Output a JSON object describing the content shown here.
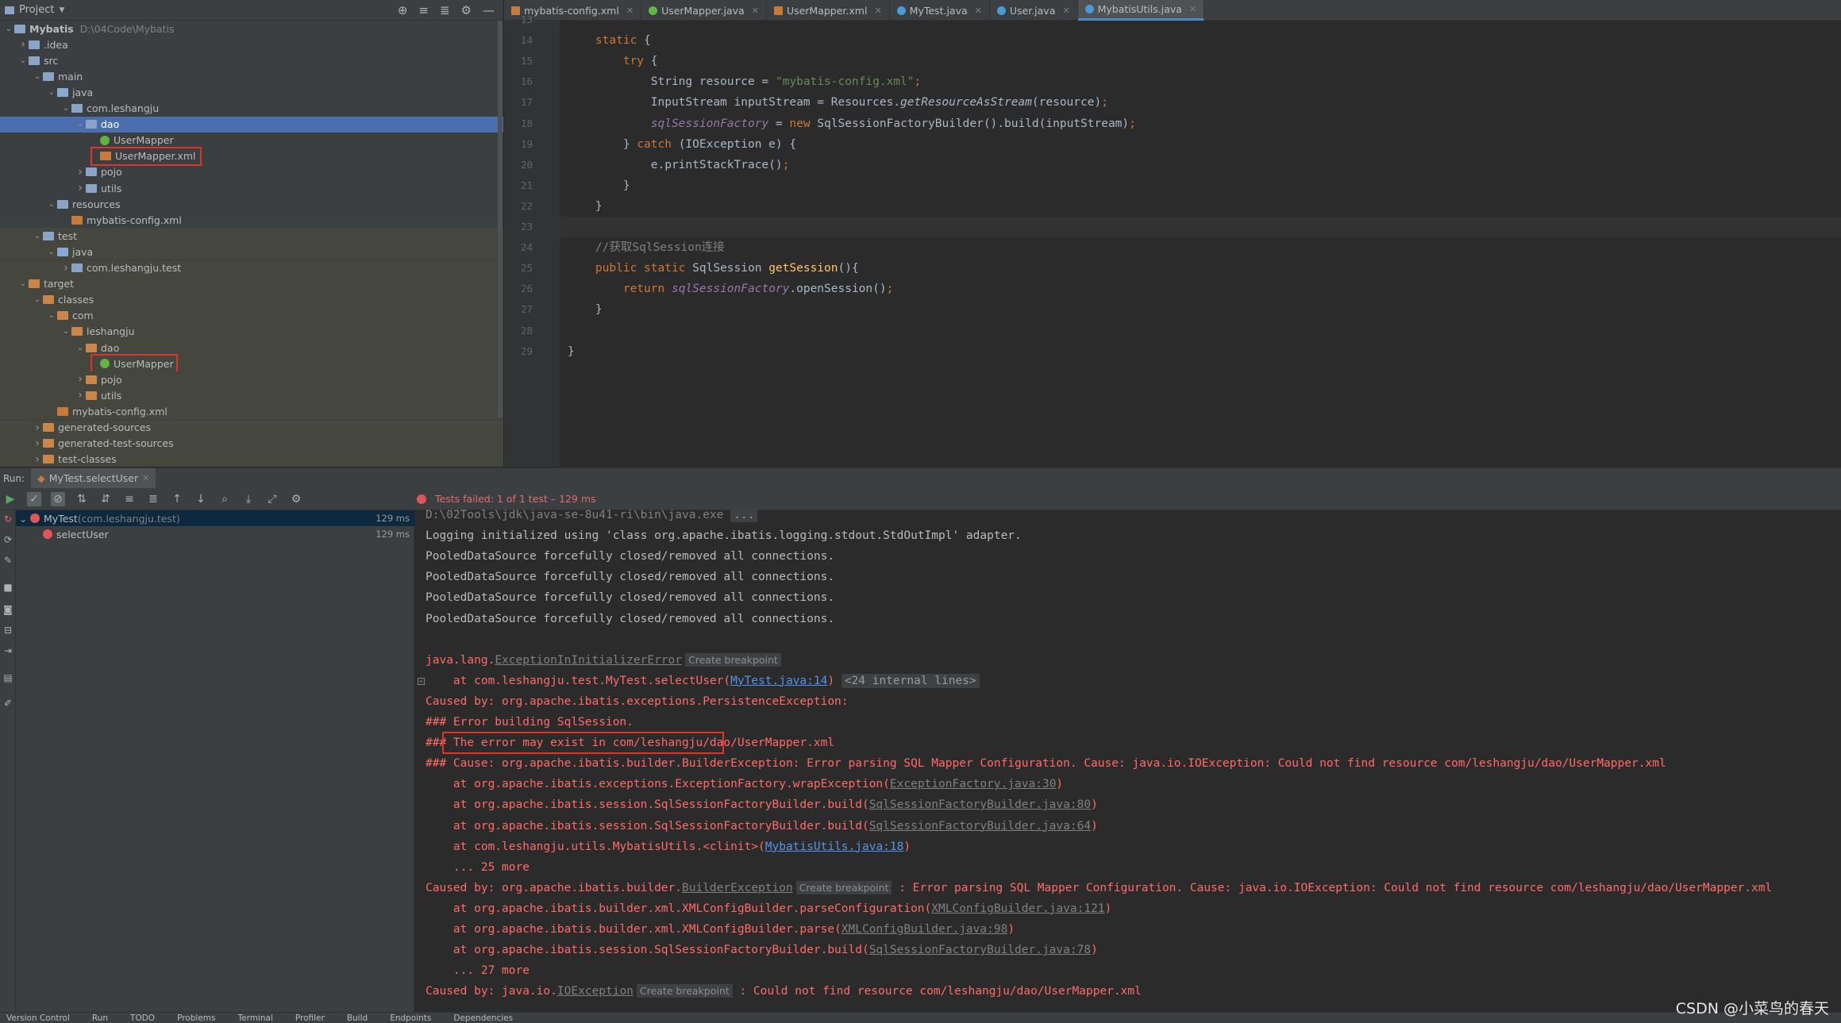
{
  "project": {
    "header_label": "Project",
    "tree": [
      {
        "label": "Mybatis",
        "hint": "D:\\04Code\\Mybatis",
        "indent": 0,
        "expanded": true,
        "icon": "folder-gray"
      },
      {
        "label": ".idea",
        "indent": 1,
        "expanded": false,
        "icon": "folder-gray"
      },
      {
        "label": "src",
        "indent": 1,
        "expanded": true,
        "icon": "folder-gray"
      },
      {
        "label": "main",
        "indent": 2,
        "expanded": true,
        "icon": "folder-gray"
      },
      {
        "label": "java",
        "indent": 3,
        "expanded": true,
        "icon": "folder-blue"
      },
      {
        "label": "com.leshangju",
        "indent": 4,
        "expanded": true,
        "icon": "folder-gray"
      },
      {
        "label": "dao",
        "indent": 5,
        "expanded": true,
        "icon": "folder-gray",
        "selected": true
      },
      {
        "label": "UserMapper",
        "indent": 6,
        "icon": "interface"
      },
      {
        "label": "UserMapper.xml",
        "indent": 6,
        "icon": "xml",
        "boxed": true
      },
      {
        "label": "pojo",
        "indent": 5,
        "expanded": false,
        "icon": "folder-gray"
      },
      {
        "label": "utils",
        "indent": 5,
        "expanded": false,
        "icon": "folder-gray"
      },
      {
        "label": "resources",
        "indent": 3,
        "expanded": true,
        "icon": "folder-gray"
      },
      {
        "label": "mybatis-config.xml",
        "indent": 4,
        "icon": "xml"
      },
      {
        "label": "test",
        "indent": 2,
        "expanded": true,
        "icon": "folder-gray",
        "tinted": true
      },
      {
        "label": "java",
        "indent": 3,
        "expanded": true,
        "icon": "folder-blue",
        "tinted": true
      },
      {
        "label": "com.leshangju.test",
        "indent": 4,
        "expanded": false,
        "icon": "folder-gray",
        "tinted": true
      },
      {
        "label": "target",
        "indent": 1,
        "expanded": true,
        "icon": "folder-orange",
        "tinted": true
      },
      {
        "label": "classes",
        "indent": 2,
        "expanded": true,
        "icon": "folder-orange",
        "tinted": true
      },
      {
        "label": "com",
        "indent": 3,
        "expanded": true,
        "icon": "folder-orange",
        "tinted": true
      },
      {
        "label": "leshangju",
        "indent": 4,
        "expanded": true,
        "icon": "folder-orange",
        "tinted": true
      },
      {
        "label": "dao",
        "indent": 5,
        "expanded": true,
        "icon": "folder-orange",
        "tinted": true
      },
      {
        "label": "UserMapper",
        "indent": 6,
        "icon": "interface",
        "boxed": true,
        "tinted": true
      },
      {
        "label": "pojo",
        "indent": 5,
        "expanded": false,
        "icon": "folder-orange",
        "tinted": true
      },
      {
        "label": "utils",
        "indent": 5,
        "expanded": false,
        "icon": "folder-orange",
        "tinted": true
      },
      {
        "label": "mybatis-config.xml",
        "indent": 3,
        "icon": "xml",
        "tinted": true
      },
      {
        "label": "generated-sources",
        "indent": 2,
        "expanded": false,
        "icon": "folder-orange",
        "tinted": true
      },
      {
        "label": "generated-test-sources",
        "indent": 2,
        "expanded": false,
        "icon": "folder-orange",
        "tinted": true
      },
      {
        "label": "test-classes",
        "indent": 2,
        "expanded": false,
        "icon": "folder-orange",
        "tinted": true
      }
    ]
  },
  "editor": {
    "tabs": [
      {
        "label": "mybatis-config.xml",
        "icon": "x"
      },
      {
        "label": "UserMapper.java",
        "icon": "i"
      },
      {
        "label": "UserMapper.xml",
        "icon": "x"
      },
      {
        "label": "MyTest.java",
        "icon": "c"
      },
      {
        "label": "User.java",
        "icon": "c"
      },
      {
        "label": "MybatisUtils.java",
        "icon": "c",
        "active": true
      }
    ],
    "lines": [
      {
        "n": "13",
        "html": ""
      },
      {
        "n": "14",
        "html": "    <span class='kw'>static</span> {"
      },
      {
        "n": "15",
        "html": "        <span class='kw'>try</span> {"
      },
      {
        "n": "16",
        "html": "            String resource = <span class='str'>\"mybatis-config.xml\"</span><span class='kw'>;</span>"
      },
      {
        "n": "17",
        "html": "            InputStream inputStream = Resources.<span class='stat'>getResourceAsStream</span>(resource)<span class='kw'>;</span>"
      },
      {
        "n": "18",
        "html": "            <span class='fld'>sqlSessionFactory</span> = <span class='kw'>new</span> SqlSessionFactoryBuilder().build(inputStream)<span class='kw'>;</span>"
      },
      {
        "n": "19",
        "html": "        } <span class='kw'>catch</span> (IOException e) {"
      },
      {
        "n": "20",
        "html": "            e.printStackTrace()<span class='kw'>;</span>"
      },
      {
        "n": "21",
        "html": "        }"
      },
      {
        "n": "22",
        "html": "    }"
      },
      {
        "n": "23",
        "html": "",
        "current": true
      },
      {
        "n": "24",
        "html": "    <span class='cmt'>//获取SqlSession连接</span>"
      },
      {
        "n": "25",
        "html": "    <span class='kw'>public static</span> SqlSession <span class='meth'>getSession</span>(){"
      },
      {
        "n": "26",
        "html": "        <span class='kw'>return</span> <span class='fld'>sqlSessionFactory</span>.openSession()<span class='kw'>;</span>"
      },
      {
        "n": "27",
        "html": "    }"
      },
      {
        "n": "28",
        "html": ""
      },
      {
        "n": "29",
        "html": "}"
      }
    ]
  },
  "run": {
    "label": "Run:",
    "tab": "MyTest.selectUser",
    "status": "Tests failed: 1 of 1 test – 129 ms",
    "tests": [
      {
        "label": "MyTest",
        "hint": "(com.leshangju.test)",
        "time": "129 ms",
        "indent": 0,
        "selected": true
      },
      {
        "label": "selectUser",
        "hint": "",
        "time": "129 ms",
        "indent": 1
      }
    ]
  },
  "console": [
    {
      "cls": "cmd",
      "html": "D:\\02Tools\\jdk\\java-se-8u41-ri\\bin\\java.exe <span class='pillmono'>...</span>"
    },
    {
      "cls": "",
      "html": "Logging initialized using 'class org.apache.ibatis.logging.stdout.StdOutImpl' adapter."
    },
    {
      "cls": "",
      "html": "PooledDataSource forcefully closed/removed all connections."
    },
    {
      "cls": "",
      "html": "PooledDataSource forcefully closed/removed all connections."
    },
    {
      "cls": "",
      "html": "PooledDataSource forcefully closed/removed all connections."
    },
    {
      "cls": "",
      "html": "PooledDataSource forcefully closed/removed all connections."
    },
    {
      "cls": "",
      "html": ""
    },
    {
      "cls": "err",
      "html": "java.lang.<span class='lnkg'>ExceptionInInitializerError</span><span class='pill'>Create breakpoint</span>"
    },
    {
      "cls": "err",
      "fold": true,
      "html": "    at com.leshangju.test.MyTest.selectUser(<span class='lnk'>MyTest.java:14</span>) <span class='pillmono'>&lt;24 internal lines&gt;</span>"
    },
    {
      "cls": "err",
      "html": "Caused by: org.apache.ibatis.exceptions.PersistenceException: "
    },
    {
      "cls": "err",
      "html": "### Error building SqlSession."
    },
    {
      "cls": "err",
      "html": "### The error may exist in com/leshangju/dao/UserMapper.xml"
    },
    {
      "cls": "err",
      "html": "### Cause: org.apache.ibatis.builder.BuilderException: Error parsing SQL Mapper Configuration. Cause: java.io.IOException: Could not find resource com/leshangju/dao/UserMapper.xml"
    },
    {
      "cls": "err",
      "html": "    at org.apache.ibatis.exceptions.ExceptionFactory.wrapException(<span class='lnkg'>ExceptionFactory.java:30</span>)"
    },
    {
      "cls": "err",
      "html": "    at org.apache.ibatis.session.SqlSessionFactoryBuilder.build(<span class='lnkg'>SqlSessionFactoryBuilder.java:80</span>)"
    },
    {
      "cls": "err",
      "html": "    at org.apache.ibatis.session.SqlSessionFactoryBuilder.build(<span class='lnkg'>SqlSessionFactoryBuilder.java:64</span>)"
    },
    {
      "cls": "err",
      "html": "    at com.leshangju.utils.MybatisUtils.&lt;clinit&gt;(<span class='lnk'>MybatisUtils.java:18</span>)"
    },
    {
      "cls": "err",
      "html": "    ... 25 more"
    },
    {
      "cls": "err",
      "html": "Caused by: org.apache.ibatis.builder.<span class='lnkg'>BuilderException</span><span class='pill'>Create breakpoint</span> : Error parsing SQL Mapper Configuration. Cause: java.io.IOException: Could not find resource com/leshangju/dao/UserMapper.xml"
    },
    {
      "cls": "err",
      "html": "    at org.apache.ibatis.builder.xml.XMLConfigBuilder.parseConfiguration(<span class='lnkg'>XMLConfigBuilder.java:121</span>)"
    },
    {
      "cls": "err",
      "html": "    at org.apache.ibatis.builder.xml.XMLConfigBuilder.parse(<span class='lnkg'>XMLConfigBuilder.java:98</span>)"
    },
    {
      "cls": "err",
      "html": "    at org.apache.ibatis.session.SqlSessionFactoryBuilder.build(<span class='lnkg'>SqlSessionFactoryBuilder.java:78</span>)"
    },
    {
      "cls": "err",
      "html": "    ... 27 more"
    },
    {
      "cls": "err",
      "html": "Caused by: java.io.<span class='lnkg'>IOException</span><span class='pill'>Create breakpoint</span> : Could not find resource com/leshangju/dao/UserMapper.xml"
    }
  ],
  "statusbar": [
    "Version Control",
    "Run",
    "TODO",
    "Problems",
    "Terminal",
    "Profiler",
    "Build",
    "Endpoints",
    "Dependencies"
  ],
  "watermark": "CSDN @小菜鸟的春天",
  "colors": {
    "accent": "#4b6eaf",
    "error": "#ff6b68",
    "annotation_box": "#e0342a"
  }
}
